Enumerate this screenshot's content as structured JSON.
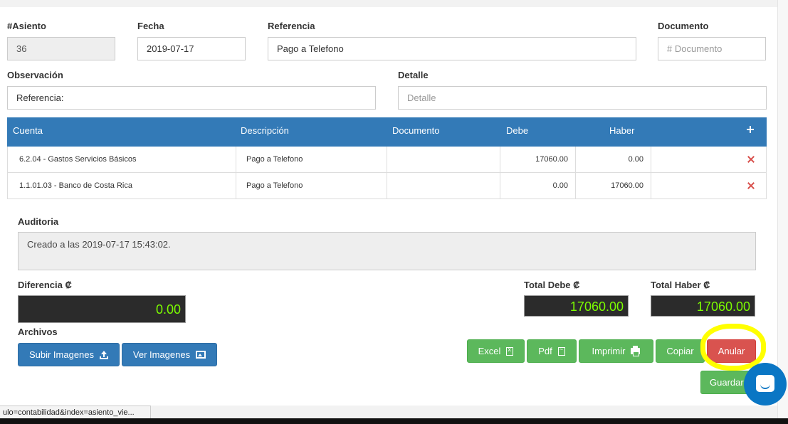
{
  "form": {
    "asiento": {
      "label": "#Asiento",
      "value": "36"
    },
    "fecha": {
      "label": "Fecha",
      "value": "2019-07-17"
    },
    "referencia": {
      "label": "Referencia",
      "value": "Pago a Telefono"
    },
    "documento": {
      "label": "Documento",
      "placeholder": "# Documento"
    },
    "observacion": {
      "label": "Observación",
      "value": "Referencia:"
    },
    "detalle": {
      "label": "Detalle",
      "placeholder": "Detalle"
    }
  },
  "table": {
    "columns": [
      "Cuenta",
      "Descripción",
      "Documento",
      "Debe",
      "Haber"
    ],
    "add_icon": "plus-icon",
    "rows": [
      {
        "cuenta": "6.2.04 - Gastos Servicios Básicos",
        "descripcion": "Pago a Telefono",
        "documento": "",
        "debe": "17060.00",
        "haber": "0.00"
      },
      {
        "cuenta": "1.1.01.03 - Banco de Costa Rica",
        "descripcion": "Pago a Telefono",
        "documento": "",
        "debe": "0.00",
        "haber": "17060.00"
      }
    ]
  },
  "auditoria": {
    "label": "Auditoria",
    "text": "Creado a las 2019-07-17 15:43:02."
  },
  "totals": {
    "diferencia": {
      "label": "Diferencia ₡",
      "value": "0.00"
    },
    "debe": {
      "label": "Total Debe ₡",
      "value": "17060.00"
    },
    "haber": {
      "label": "Total Haber ₡",
      "value": "17060.00"
    }
  },
  "archivos": {
    "label": "Archivos",
    "subir": "Subir Imagenes",
    "ver": "Ver Imagenes"
  },
  "actions": {
    "excel": "Excel",
    "pdf": "Pdf",
    "imprimir": "Imprimir",
    "copiar": "Copiar",
    "anular": "Anular",
    "guardar": "Guardar"
  },
  "status_bar": "ulo=contabilidad&index=asiento_vie...",
  "colors": {
    "primary": "#337ab7",
    "success": "#5cb85c",
    "danger": "#d9534f",
    "total_text": "#7cfc00",
    "highlight": "#ffff00",
    "chat": "#0a76c4"
  }
}
